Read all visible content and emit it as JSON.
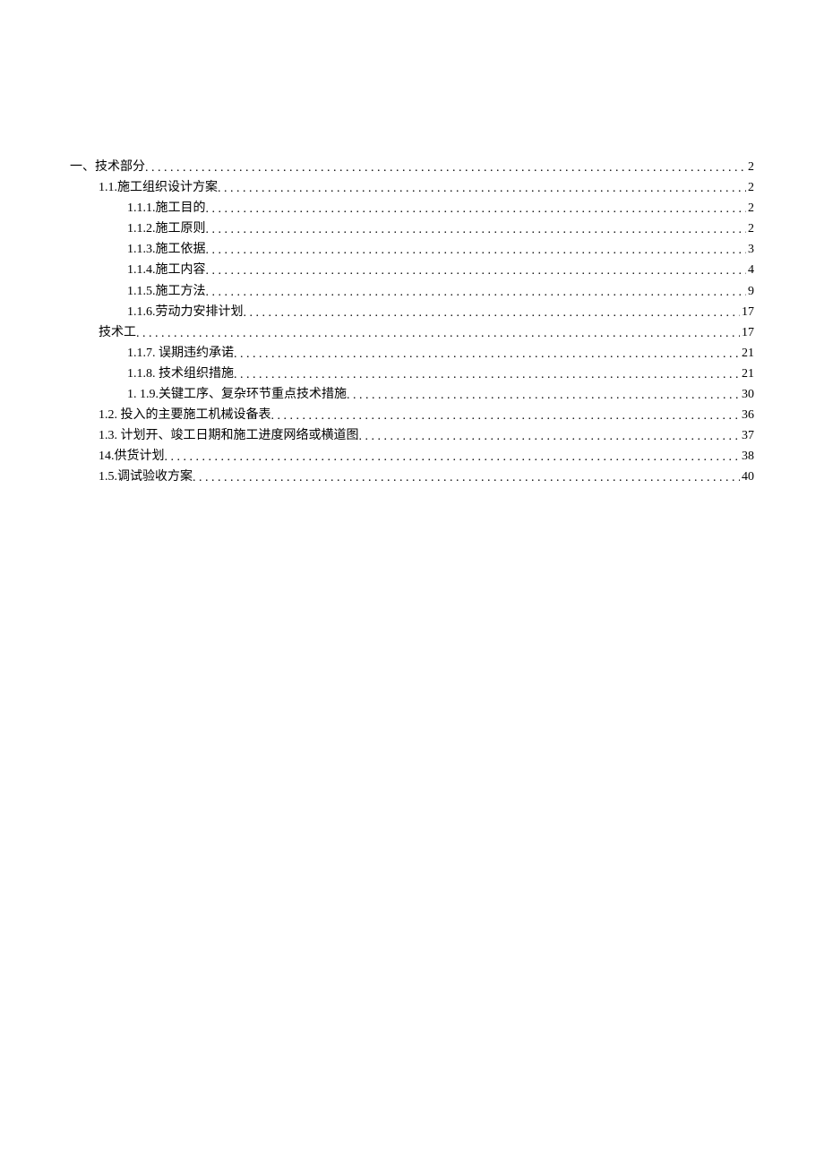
{
  "toc": [
    {
      "indent": 0,
      "label": "一、技术部分",
      "page": "2"
    },
    {
      "indent": 1,
      "label": "1.1.施工组织设计方案",
      "page": "2"
    },
    {
      "indent": 2,
      "label": "1.1.1.施工目的",
      "page": "2"
    },
    {
      "indent": 2,
      "label": "1.1.2.施工原则",
      "page": "2"
    },
    {
      "indent": 2,
      "label": "1.1.3.施工依据",
      "page": "3"
    },
    {
      "indent": 2,
      "label": "1.1.4.施工内容",
      "page": "4"
    },
    {
      "indent": 2,
      "label": "1.1.5.施工方法",
      "page": "9"
    },
    {
      "indent": 2,
      "label": "1.1.6.劳动力安排计划",
      "page": "17"
    },
    {
      "indent": 1,
      "label": "技术工",
      "page": "17"
    },
    {
      "indent": 2,
      "label": "1.1.7.  误期违约承诺",
      "page": "21"
    },
    {
      "indent": 2,
      "label": "1.1.8.  技术组织措施",
      "page": "21"
    },
    {
      "indent": 2,
      "label": "1.  1.9.关键工序、复杂环节重点技术措施",
      "page": "30"
    },
    {
      "indent": 1,
      "label": "1.2.  投入的主要施工机械设备表",
      "page": "36"
    },
    {
      "indent": 1,
      "label": "1.3.  计划开、竣工日期和施工进度网络或横道图",
      "page": "37"
    },
    {
      "indent": 1,
      "label": "14.供货计划",
      "page": "38"
    },
    {
      "indent": 1,
      "label": "1.5.调试验收方案",
      "page": "40"
    }
  ]
}
